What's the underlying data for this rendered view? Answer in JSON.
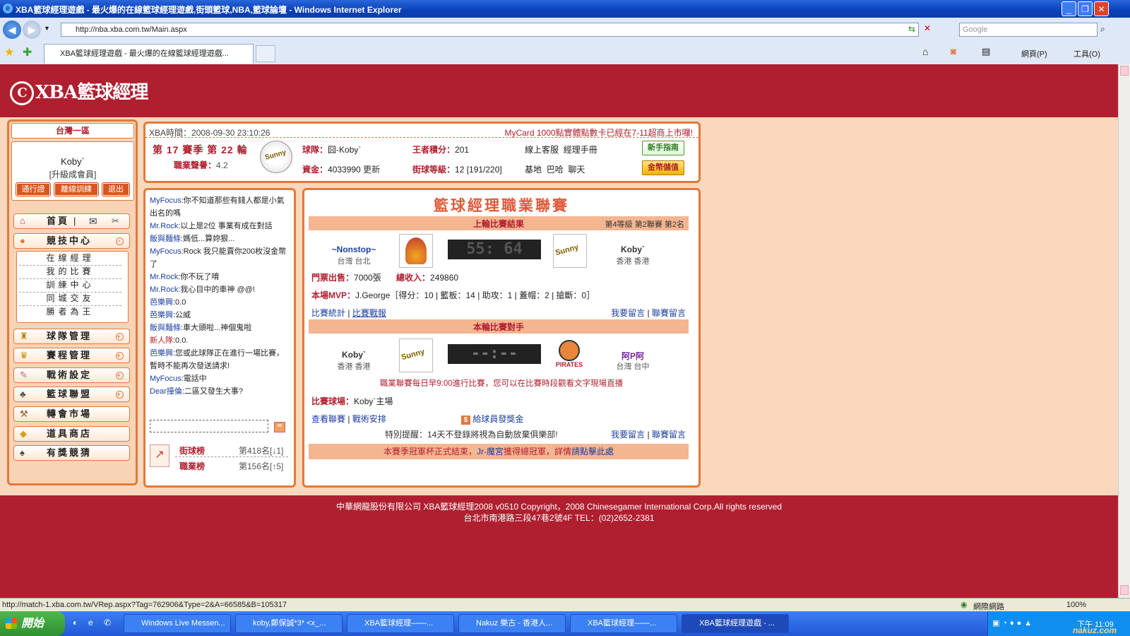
{
  "browser": {
    "window_title": "XBA籃球經理遊戲 - 最火爆的在線籃球經理遊戲,街頭籃球,NBA,籃球論壇 - Windows Internet Explorer",
    "address": "http://nba.xba.com.tw/Main.aspx",
    "search_placeholder": "Google",
    "tab_title": "XBA籃球經理遊戲 - 最火爆的在線籃球經理遊戲...",
    "toolbar": {
      "page": "網頁(P)",
      "tools": "工具(O)"
    },
    "status_url": "http://match-1.xba.com.tw/VRep.aspx?Tag=762906&Type=2&A=66585&B=105317",
    "status_zone": "網際網路",
    "zoom": "100%"
  },
  "site": {
    "logo": "XBA籃球經理",
    "server": "台灣一區",
    "user": "Koby`",
    "upgrade": "[升級成會員]",
    "buttons": [
      "通行證",
      "離線訓練",
      "退出"
    ]
  },
  "nav": {
    "home": "首頁",
    "sections": [
      {
        "label": "競技中心",
        "icon": "basketball-icon"
      },
      {
        "label": "球隊管理",
        "icon": "team-icon"
      },
      {
        "label": "賽程管理",
        "icon": "trophy-icon"
      },
      {
        "label": "戰術設定",
        "icon": "tactics-icon"
      },
      {
        "label": "籃球聯盟",
        "icon": "league-icon"
      },
      {
        "label": "轉會市場",
        "icon": "hammer-icon"
      },
      {
        "label": "道具商店",
        "icon": "shop-icon"
      },
      {
        "label": "有獎競猜",
        "icon": "quiz-icon"
      }
    ],
    "sub_items": [
      "在線經理",
      "我的比賽",
      "訓練中心",
      "同城交友",
      "勝者為王"
    ]
  },
  "info": {
    "time_label": "XBA時間：",
    "time": "2008-09-30 23:10:26",
    "notice": "MyCard 1000點實體點數卡已經在7-11超商上市囉!",
    "season": "第 17 賽季 第 22 輪",
    "career_label": "職業聲譽：",
    "career": "4.2",
    "team_label": "球隊：",
    "team": "囧-Koby`",
    "king_label": "王者積分：",
    "king": "201",
    "service": "線上客服",
    "manual": "經理手冊",
    "guide_btn": "新手指南",
    "funds_label": "資金：",
    "funds": "4033990",
    "refresh": "更新",
    "street_label": "街球等級：",
    "street": "12 [191/220]",
    "base": "基地",
    "baha": "巴哈",
    "chat": "聊天",
    "coin_btn": "金幣儲值"
  },
  "chat": [
    {
      "name": "MyFocus",
      "text": ":你不知道那些有錢人都是小氣出名的嗎"
    },
    {
      "name": "Mr.Rock",
      "text": ":以上是2位 事業有成在對話"
    },
    {
      "name": "飯與麵條",
      "text": ":媽低...算妳狠..."
    },
    {
      "name": "MyFocus",
      "text": ":Rock 我只能賣你200枚沒金幣了"
    },
    {
      "name": "Mr.Rock",
      "text": ":你不玩了唷"
    },
    {
      "name": "Mr.Rock",
      "text": ":我心目中的車神 @@!"
    },
    {
      "name": "芭樂興",
      "text": ":0.0"
    },
    {
      "name": "芭樂興",
      "text": ":公威"
    },
    {
      "name": "飯與麵條",
      "text": ":車大頭啦...神個鬼啦"
    },
    {
      "name": "新人隊",
      "text": ":0.0."
    },
    {
      "name": "芭樂興",
      "text": ":您或此球隊正在進行一場比賽，暫時不能再次發送請求!"
    },
    {
      "name": "MyFocus",
      "text": ":電話中"
    },
    {
      "name": "Dear撞倫",
      "text": ":二區又發生大事?"
    }
  ],
  "rank": {
    "street_label": "街球榜",
    "street": "第418名[↓1]",
    "career_label": "職業榜",
    "career": "第156名[↑5]"
  },
  "league": {
    "title": "籃球經理職業聯賽",
    "last_header": "上輪比賽結果",
    "level": "第4等級 第2聯賽 第2名",
    "home_team": "~Nonstop~",
    "home_loc": "台灣 台北",
    "score": "55: 64",
    "away_team": "Koby`",
    "away_loc": "香港 香港",
    "tickets_label": "門票出售：",
    "tickets": "7000張",
    "income_label": "總收入：",
    "income": "249860",
    "mvp_label": "本場MVP：",
    "mvp": "J.George［得分：10 | 籃板：14 | 助攻：1 | 蓋帽：2 | 搶斷：0］",
    "stats_link": "比賽統計",
    "report_link": "比賽戰報",
    "msg_link": "我要留言",
    "league_msg_link": "聯賽留言",
    "next_header": "本輪比賽對手",
    "next_home": "Koby`",
    "next_home_loc": "香港 香港",
    "next_score": "--:--",
    "next_away": "阿P阿",
    "next_away_loc": "台灣 台中",
    "schedule_note": "職業聯賽每日早9:00進行比賽，您可以在比賽時段觀看文字現場直播",
    "arena_label": "比賽球場：",
    "arena": "Koby`主場",
    "view_league": "查看聯賽",
    "tactics": "戰術安排",
    "bonus": "給球員發獎金",
    "warning": "特別提醒：14天不登錄將視為自動放棄俱樂部!",
    "cup_note_a": "本賽季冠軍杯正式結束，",
    "cup_winner": "Jr-魔宮",
    "cup_note_b": "獲得總冠軍，詳情",
    "cup_link": "請點擊此處",
    "pirates": "PIRATES"
  },
  "footer": {
    "line1": "中華網龍股份有限公司 XBA籃球經理2008 v0510    Copyright，2008 Chinesegamer International Corp.All rights reserved",
    "line2": "台北市南港路三段47巷2號4F TEL：(02)2652-2381"
  },
  "taskbar": {
    "start": "開始",
    "tasks": [
      "Windows Live Messen...",
      "koby,鄭保誠*3* <x_...",
      "XBA籃球經理——...",
      "Nakuz 樂古 - 香港人...",
      "XBA籃球經理——...",
      "XBA籃球經理遊戲 - ..."
    ],
    "clock": "下午 11:09",
    "watermark": "nakuz.com"
  },
  "colors": {
    "page_bg": "#b01f2f",
    "content_bg": "#fbd8bd",
    "accent": "#e07a3c",
    "link": "#1b3ea0"
  }
}
